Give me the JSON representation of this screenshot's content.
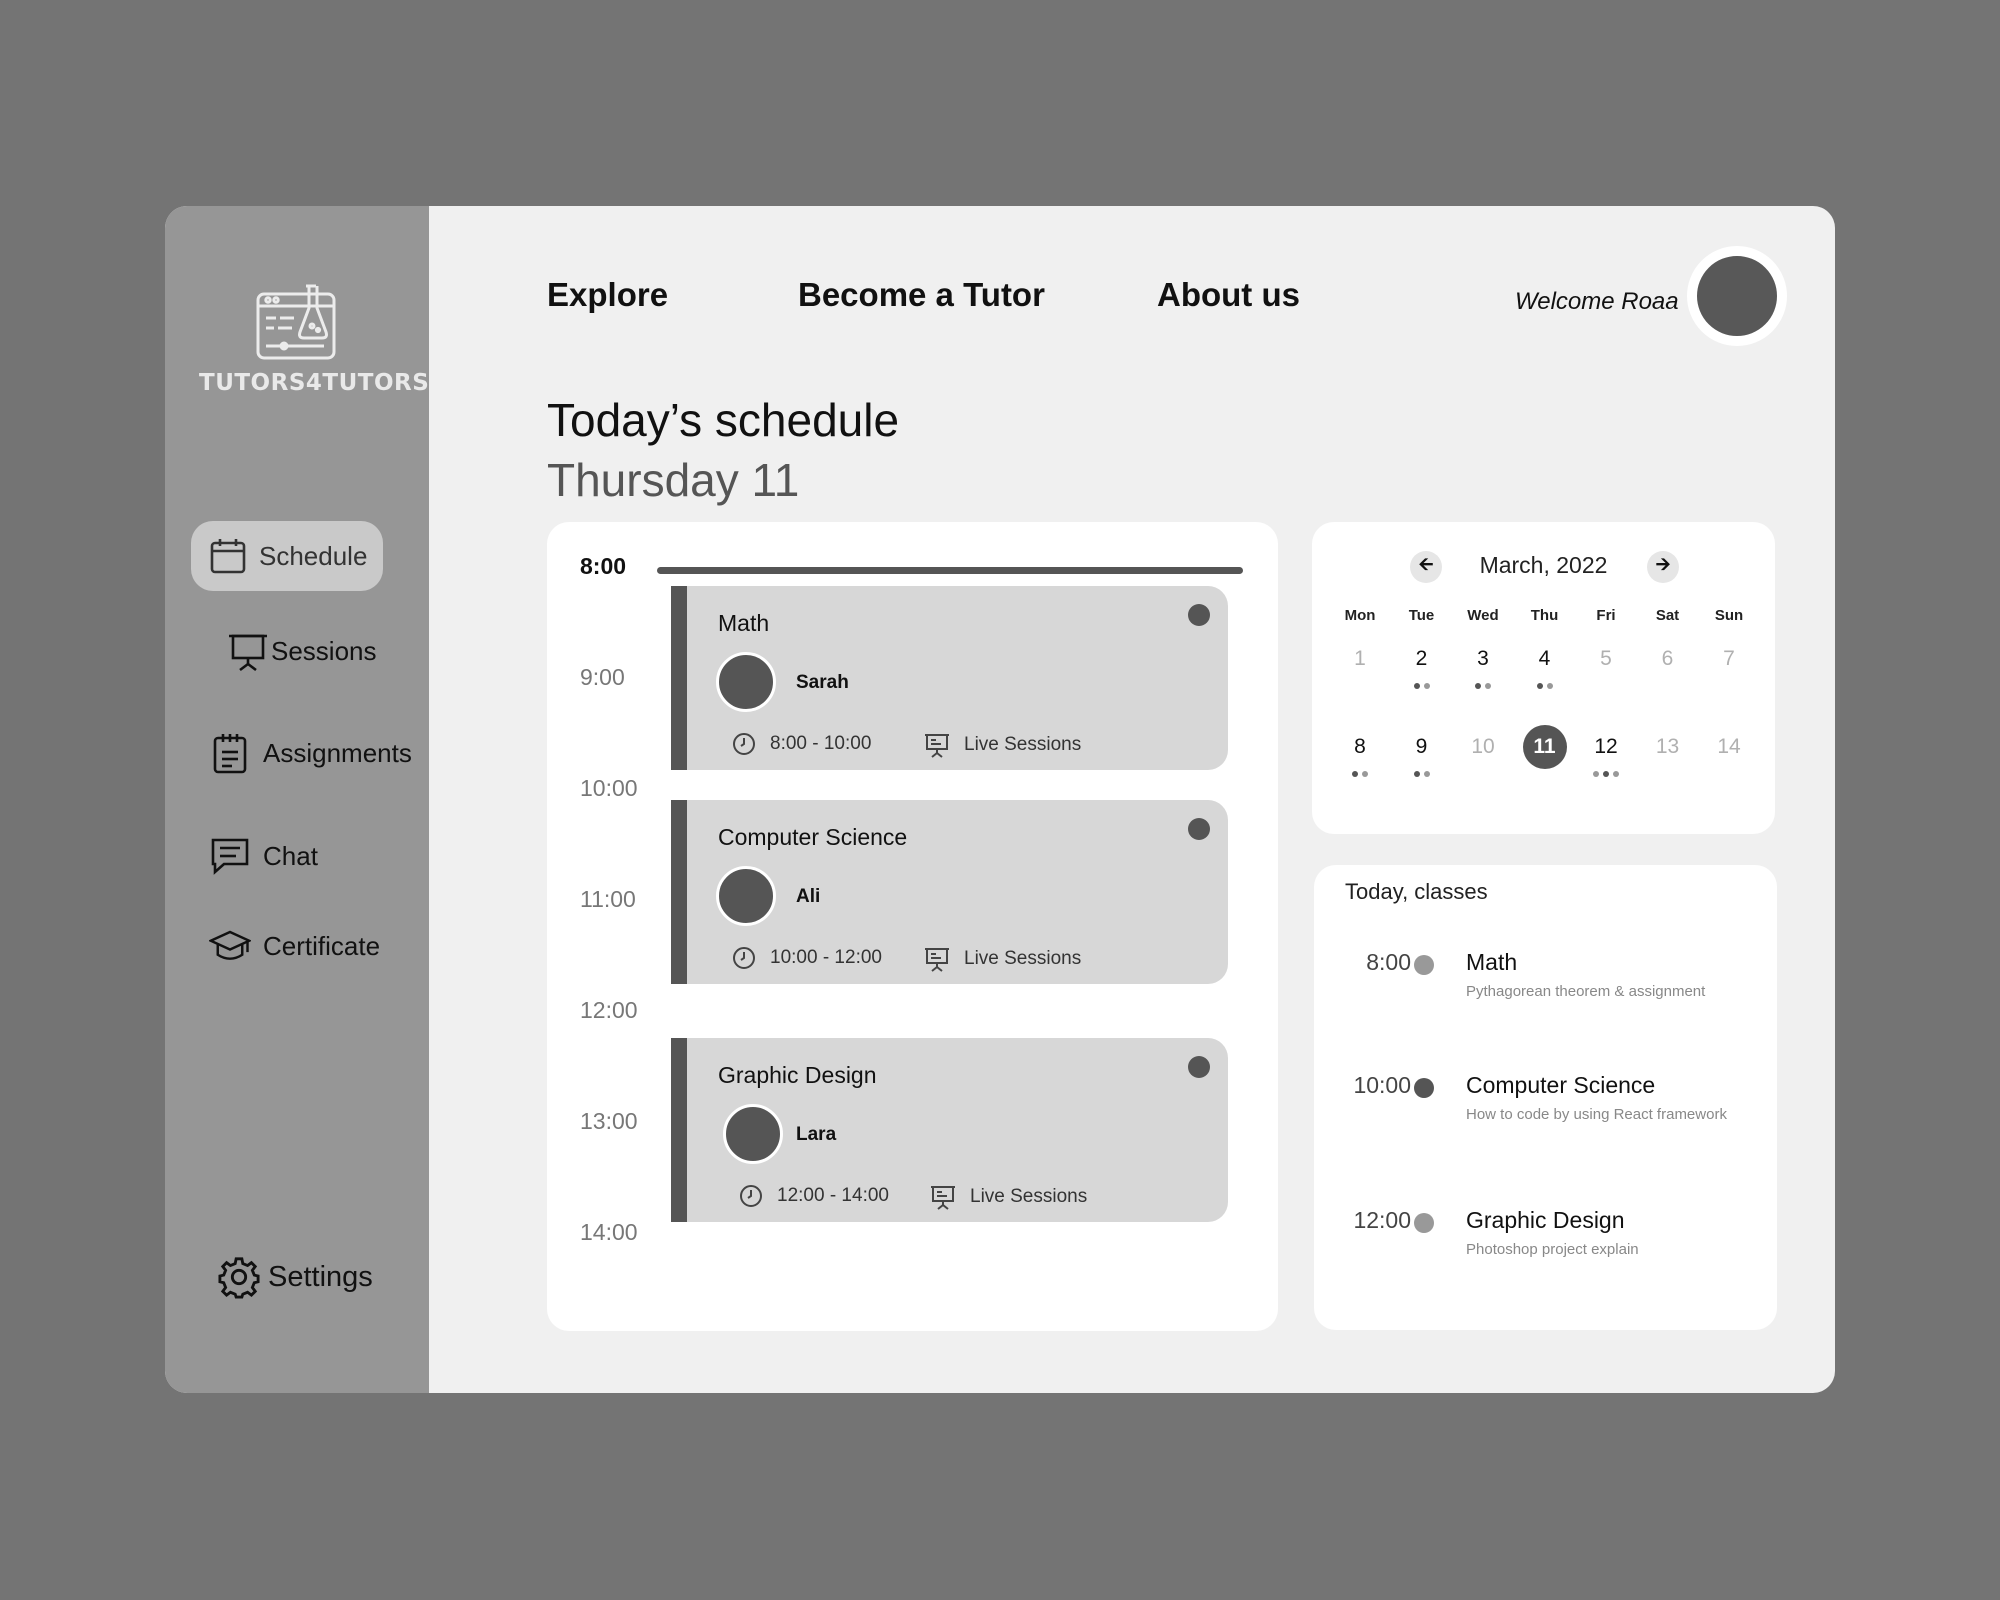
{
  "app": {
    "logo_text": "TUTORS4TUTORS"
  },
  "sidebar": {
    "items": [
      {
        "label": "Schedule",
        "icon": "calendar-icon",
        "active": true
      },
      {
        "label": "Sessions",
        "icon": "presentation-board-icon"
      },
      {
        "label": "Assignments",
        "icon": "clipboard-icon"
      },
      {
        "label": "Chat",
        "icon": "chat-icon"
      },
      {
        "label": "Certificate",
        "icon": "graduation-cap-icon"
      }
    ],
    "settings_label": "Settings"
  },
  "topnav": {
    "links": [
      "Explore",
      "Become a Tutor",
      "About us"
    ],
    "welcome": "Welcome Roaa"
  },
  "page": {
    "title": "Today’s schedule",
    "subtitle": "Thursday 11"
  },
  "timeline": {
    "hours": [
      "8:00",
      "9:00",
      "10:00",
      "11:00",
      "12:00",
      "13:00",
      "14:00"
    ],
    "sessions": [
      {
        "title": "Math",
        "tutor": "Sarah",
        "time": "8:00 - 10:00",
        "type": "Live Sessions"
      },
      {
        "title": "Computer Science",
        "tutor": "Ali",
        "time": "10:00 - 12:00",
        "type": "Live Sessions"
      },
      {
        "title": "Graphic Design",
        "tutor": "Lara",
        "time": "12:00 - 14:00",
        "type": "Live Sessions"
      }
    ]
  },
  "calendar": {
    "month": "March, 2022",
    "weekdays": [
      "Mon",
      "Tue",
      "Wed",
      "Thu",
      "Fri",
      "Sat",
      "Sun"
    ],
    "week1": [
      "1",
      "2",
      "3",
      "4",
      "5",
      "6",
      "7"
    ],
    "week2": [
      "8",
      "9",
      "10",
      "11",
      "12",
      "13",
      "14"
    ],
    "selected_day": "11"
  },
  "today_classes": {
    "title": "Today, classes",
    "items": [
      {
        "time": "8:00",
        "name": "Math",
        "desc": "Pythagorean theorem & assignment"
      },
      {
        "time": "10:00",
        "name": "Computer Science",
        "desc": "How to code by using React framework"
      },
      {
        "time": "12:00",
        "name": "Graphic Design",
        "desc": "Photoshop project explain"
      }
    ]
  },
  "colors": {
    "background": "#747474",
    "sidebar": "#969696",
    "accent": "#555555",
    "card": "#d7d7d7"
  }
}
